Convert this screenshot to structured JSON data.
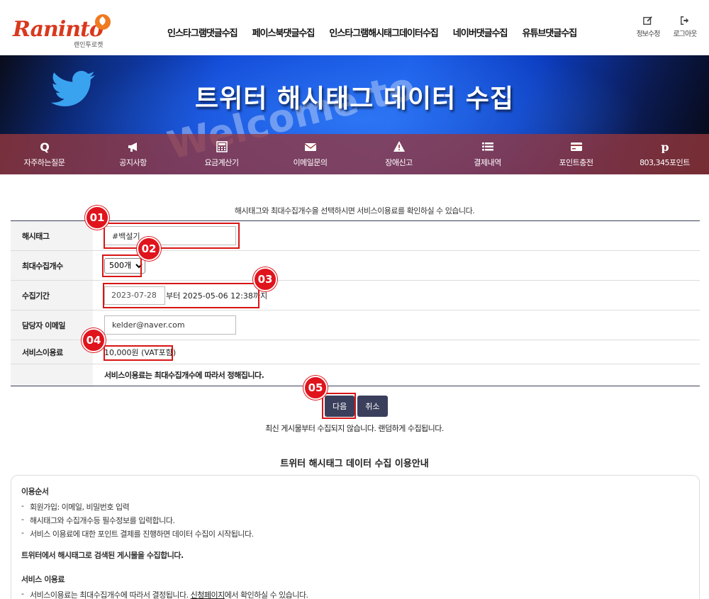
{
  "brand": {
    "logo_text": "Raninto",
    "logo_sub": "랜인투로켓"
  },
  "nav": {
    "items": [
      "인스타그램댓글수집",
      "페이스북댓글수집",
      "인스타그램해시태그데이터수집",
      "네이버댓글수집",
      "유튜브댓글수집"
    ]
  },
  "user_menu": {
    "edit_label": "정보수정",
    "logout_label": "로그아웃"
  },
  "banner": {
    "title": "트위터 해시태그 데이터 수집",
    "bg_word": "Welcome to"
  },
  "quickbar": {
    "items": [
      {
        "label": "자주하는질문",
        "icon": "q-icon"
      },
      {
        "label": "공지사항",
        "icon": "megaphone-icon"
      },
      {
        "label": "요금계산기",
        "icon": "calculator-icon"
      },
      {
        "label": "이메일문의",
        "icon": "envelope-icon"
      },
      {
        "label": "장애신고",
        "icon": "warning-icon"
      },
      {
        "label": "결제내역",
        "icon": "list-icon"
      },
      {
        "label": "포인트충전",
        "icon": "card-icon"
      },
      {
        "label": "803,345포인트",
        "icon": "pinterest-icon"
      }
    ]
  },
  "form": {
    "intro": "해시태그와 최대수집개수을 선택하시면 서비스이용료를 확인하실 수 있습니다.",
    "hashtag": {
      "label": "해시태그",
      "value": "#백설기"
    },
    "max_count": {
      "label": "최대수집개수",
      "value": "500개"
    },
    "period": {
      "label": "수집기간",
      "start": "2023-07-28",
      "suffix": "부터 2025-05-06 12:38까지"
    },
    "email": {
      "label": "담당자 이메일",
      "value": "kelder@naver.com"
    },
    "fee": {
      "label": "서비스이용료",
      "value": "10,000원 (VAT포함)"
    },
    "fee_note": "서비스이용료는 최대수집개수에 따라서 정해집니다."
  },
  "badges": [
    "01",
    "02",
    "03",
    "04",
    "05"
  ],
  "buttons": {
    "next": "다음",
    "cancel": "취소"
  },
  "warning": "최신 게시물부터 수집되지 않습니다. 랜덤하게 수집됩니다.",
  "guide": {
    "title": "트위터 해시태그 데이터 수집 이용안내",
    "order_title": "이용순서",
    "order_items": [
      "회원가입: 이메일, 비밀번호 입력",
      "해시태그와 수집개수등 필수정보를 입력합니다.",
      "서비스 이용료에 대한 포인트 결제를 진행하면 데이터 수집이 시작됩니다."
    ],
    "para": "트위터에서 해시태그로 검색된 게시물을 수집합니다.",
    "fee_title": "서비스 이용료",
    "fee_item_pre": "서비스이용료는 최대수집개수에 따라서 결정됩니다. ",
    "fee_item_link": "신청페이지",
    "fee_item_post": "에서 확인하실 수 있습니다."
  },
  "colors": {
    "accent": "#3a3f5c",
    "badge": "#e0141c",
    "quickbar": "#96373c"
  }
}
